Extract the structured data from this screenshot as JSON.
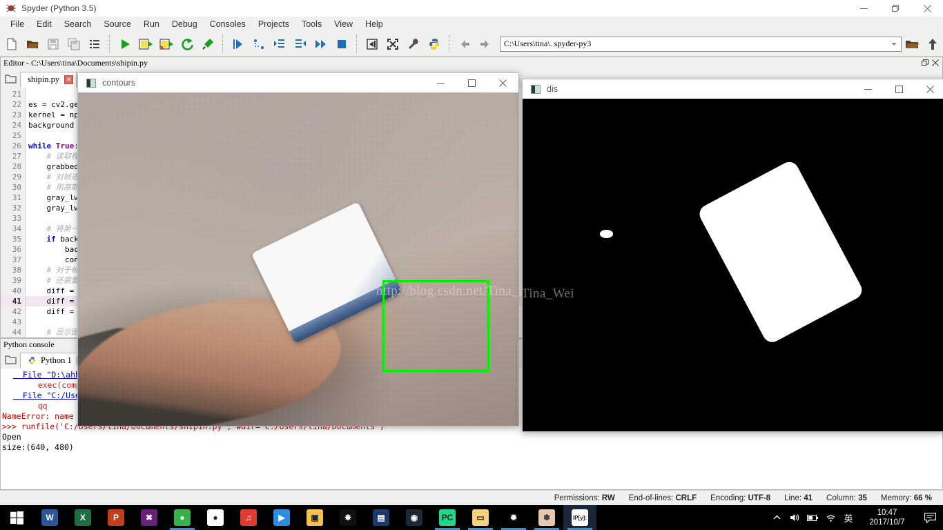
{
  "window": {
    "title": "Spyder (Python 3.5)",
    "app_icon": "spyder-icon",
    "controls": {
      "minimize": "—",
      "maximize": "❐",
      "close": "✕"
    }
  },
  "menubar": {
    "items": [
      "File",
      "Edit",
      "Search",
      "Source",
      "Run",
      "Debug",
      "Consoles",
      "Projects",
      "Tools",
      "View",
      "Help"
    ]
  },
  "toolbar": {
    "groups": [
      [
        "new-file-icon",
        "open-file-icon",
        "save-file-icon",
        "save-all-icon",
        "list-icon"
      ],
      [
        "run-file-icon",
        "run-cell-icon",
        "run-cell-advance-icon",
        "re-run-icon",
        "configure-run-icon"
      ],
      [
        "debug-file-icon",
        "step-over-icon",
        "step-into-icon",
        "step-return-icon",
        "continue-icon",
        "stop-debug-icon"
      ],
      [
        "maximize-pane-icon",
        "fullscreen-icon",
        "preferences-icon",
        "pythonpath-icon"
      ]
    ],
    "nav_back": "back-arrow-icon",
    "nav_forward": "forward-arrow-icon",
    "path_value": "C:\\Users\\tina\\. spyder-py3",
    "browse_dir_icon": "folder-icon",
    "parent_dir_icon": "up-arrow-icon"
  },
  "editor": {
    "pane_title": "Editor - C:\\Users\\tina\\Documents\\shipin.py",
    "header_buttons": [
      "undock-icon",
      "close-pane-icon"
    ],
    "browse_tabs_icon": "browse-tabs-icon",
    "tabs": [
      {
        "label": "shipin.py",
        "close": "✕",
        "active": true
      }
    ],
    "current_line": 41,
    "lines": [
      {
        "n": 21,
        "segments": []
      },
      {
        "n": 22,
        "segments": [
          {
            "t": "es = cv2.ge",
            "c": ""
          }
        ]
      },
      {
        "n": 23,
        "segments": [
          {
            "t": "kernel = np",
            "c": ""
          }
        ]
      },
      {
        "n": 24,
        "segments": [
          {
            "t": "background",
            "c": ""
          }
        ]
      },
      {
        "n": 25,
        "segments": []
      },
      {
        "n": 26,
        "segments": [
          {
            "t": "while ",
            "c": "kw"
          },
          {
            "t": "True",
            "c": "bi"
          },
          {
            "t": ":",
            "c": ""
          }
        ]
      },
      {
        "n": 27,
        "segments": [
          {
            "t": "    # 读取视",
            "c": "cmt"
          }
        ]
      },
      {
        "n": 28,
        "segments": [
          {
            "t": "    grabbed",
            "c": ""
          }
        ]
      },
      {
        "n": 29,
        "segments": [
          {
            "t": "    # 对帧进",
            "c": "cmt"
          }
        ]
      },
      {
        "n": 30,
        "segments": [
          {
            "t": "    # 用高斯",
            "c": "cmt"
          }
        ]
      },
      {
        "n": 31,
        "segments": [
          {
            "t": "    gray_lw",
            "c": ""
          }
        ]
      },
      {
        "n": 32,
        "segments": [
          {
            "t": "    gray_lw",
            "c": ""
          }
        ]
      },
      {
        "n": 33,
        "segments": []
      },
      {
        "n": 34,
        "segments": [
          {
            "t": "    # 将第一",
            "c": "cmt"
          }
        ]
      },
      {
        "n": 35,
        "segments": [
          {
            "t": "    ",
            "c": ""
          },
          {
            "t": "if",
            "c": "kw"
          },
          {
            "t": " back",
            "c": ""
          }
        ]
      },
      {
        "n": 36,
        "segments": [
          {
            "t": "        bac",
            "c": ""
          }
        ]
      },
      {
        "n": 37,
        "segments": [
          {
            "t": "        con",
            "c": ""
          }
        ]
      },
      {
        "n": 38,
        "segments": [
          {
            "t": "    # 对于帧",
            "c": "cmt"
          }
        ]
      },
      {
        "n": 39,
        "segments": [
          {
            "t": "    # 还需要",
            "c": "cmt"
          }
        ]
      },
      {
        "n": 40,
        "segments": [
          {
            "t": "    diff = ",
            "c": ""
          }
        ]
      },
      {
        "n": 41,
        "segments": [
          {
            "t": "    diff = ",
            "c": ""
          }
        ]
      },
      {
        "n": 42,
        "segments": [
          {
            "t": "    diff = ",
            "c": ""
          }
        ]
      },
      {
        "n": 43,
        "segments": []
      },
      {
        "n": 44,
        "segments": [
          {
            "t": "    # 显示图",
            "c": "cmt"
          }
        ]
      }
    ]
  },
  "console": {
    "pane_title": "Python console",
    "browse_tabs_icon": "browse-tabs-icon",
    "tabs": [
      {
        "label": "Python 1",
        "icon": "python-icon",
        "close": "✕",
        "active": true
      }
    ],
    "lines": [
      {
        "text": "  File \"D:\\ahhhh",
        "style": "file"
      },
      {
        "text": "    exec(compile",
        "style": "code"
      },
      {
        "text": "  File \"C:/Users",
        "style": "file"
      },
      {
        "text": "    qq",
        "style": "code"
      },
      {
        "text": "NameError: name 'qq' is not defined",
        "style": "err"
      },
      {
        "text": ">>> runfile('C:/Users/tina/Documents/shipin.py', wdir='C:/Users/tina/Documents')",
        "style": "prompt"
      },
      {
        "text": "Open",
        "style": "plain"
      },
      {
        "text": "size:(640, 480)",
        "style": "plain"
      }
    ]
  },
  "statusbar": {
    "items": [
      {
        "label": "Permissions:",
        "value": "RW"
      },
      {
        "label": "End-of-lines:",
        "value": "CRLF"
      },
      {
        "label": "Encoding:",
        "value": "UTF-8"
      },
      {
        "label": "Line:",
        "value": "41"
      },
      {
        "label": "Column:",
        "value": "35"
      },
      {
        "label": "Memory:",
        "value": "66 %"
      }
    ]
  },
  "cv_windows": [
    {
      "id": "contours",
      "title": "contours",
      "icon": "opencv-window-icon",
      "buttons": {
        "minimize": "—",
        "maximize": "☐",
        "close": "✕"
      },
      "watermark": "http://blog.csdn.net/Tina_Wei"
    },
    {
      "id": "dis",
      "title": "dis",
      "icon": "opencv-window-icon",
      "buttons": {
        "minimize": "—",
        "maximize": "☐",
        "close": "✕"
      },
      "watermark": "Tina_Wei"
    }
  ],
  "taskbar": {
    "start_icon": "windows-start-icon",
    "apps": [
      {
        "name": "word-icon",
        "label": "W",
        "bg": "#2b579a",
        "running": false
      },
      {
        "name": "excel-icon",
        "label": "X",
        "bg": "#1d6f42",
        "running": false
      },
      {
        "name": "powerpoint-icon",
        "label": "P",
        "bg": "#c43e1c",
        "running": false
      },
      {
        "name": "visual-studio-icon",
        "label": "✖",
        "bg": "#68217a",
        "running": false
      },
      {
        "name": "sogou-browser-icon",
        "label": "●",
        "bg": "#35b34a",
        "running": true
      },
      {
        "name": "qq-icon",
        "label": "●",
        "bg": "#ffffff",
        "running": false
      },
      {
        "name": "netease-music-icon",
        "label": "♫",
        "bg": "#e13b30",
        "running": false
      },
      {
        "name": "thunder-icon",
        "label": "▶",
        "bg": "#2b8ee0",
        "running": false
      },
      {
        "name": "vmware-icon",
        "label": "▣",
        "bg": "#f2c14e",
        "running": false
      },
      {
        "name": "anaconda-icon",
        "label": "✸",
        "bg": "#111111",
        "running": false
      },
      {
        "name": "jetbrains-icon",
        "label": "▤",
        "bg": "#1b3a6b",
        "running": false
      },
      {
        "name": "steam-icon",
        "label": "◉",
        "bg": "#1b2838",
        "running": false
      },
      {
        "name": "pycharm-icon",
        "label": "PC",
        "bg": "#21d789",
        "running": true
      },
      {
        "name": "file-explorer-icon",
        "label": "▭",
        "bg": "#f6d37a",
        "running": true
      },
      {
        "name": "spider-app-icon",
        "label": "✹",
        "bg": "#000000",
        "running": true
      },
      {
        "name": "image-viewer-icon",
        "label": "❄",
        "bg": "#e8c7b0",
        "running": true
      },
      {
        "name": "ipython-spyder-icon",
        "label": "IP[y]:",
        "bg": "#ffffff",
        "running": true,
        "active": true
      }
    ],
    "tray": {
      "chevron": "show-hidden-icons",
      "volume": "volume-icon",
      "battery": "battery-icon",
      "network": "wifi-icon",
      "ime": "英",
      "time": "10:47",
      "date": "2017/10/7",
      "action_center": "action-center-icon"
    }
  },
  "colors": {
    "accent_green": "#00f000",
    "taskbar_bg": "#000000",
    "pane_border": "#b8b8b8",
    "current_line": "#f3e6f0"
  }
}
